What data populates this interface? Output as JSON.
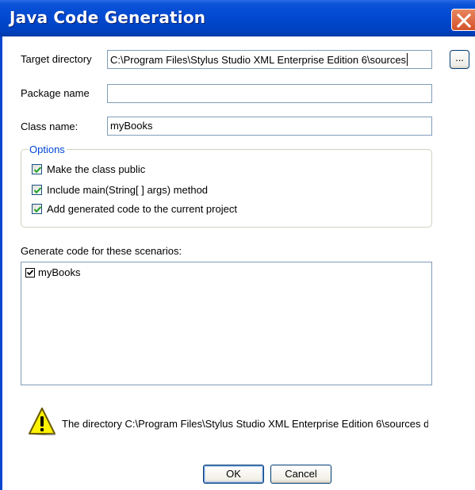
{
  "window": {
    "title": "Java Code Generation",
    "close_icon": "close-icon",
    "colors": {
      "titlebar": "#0048d0",
      "close": "#d4522a",
      "group_title": "#0046d5"
    }
  },
  "fields": {
    "target_directory": {
      "label": "Target directory",
      "value": "C:\\Program Files\\Stylus Studio XML Enterprise Edition 6\\sources",
      "browse_label": "..."
    },
    "package_name": {
      "label": "Package name",
      "value": ""
    },
    "class_name": {
      "label": "Class name:",
      "value": "myBooks"
    }
  },
  "options": {
    "title": "Options",
    "items": [
      {
        "label": "Make the class public",
        "checked": true
      },
      {
        "label": "Include main(String[ ] args) method",
        "checked": true
      },
      {
        "label": "Add generated code to the current project",
        "checked": true
      }
    ]
  },
  "scenarios": {
    "label": "Generate code for these scenarios:",
    "items": [
      {
        "label": "myBooks",
        "checked": true
      }
    ]
  },
  "warning": {
    "icon": "warning-icon",
    "text": "The directory C:\\Program Files\\Stylus Studio XML Enterprise Edition 6\\sources does not exist."
  },
  "buttons": {
    "ok": "OK",
    "cancel": "Cancel"
  }
}
